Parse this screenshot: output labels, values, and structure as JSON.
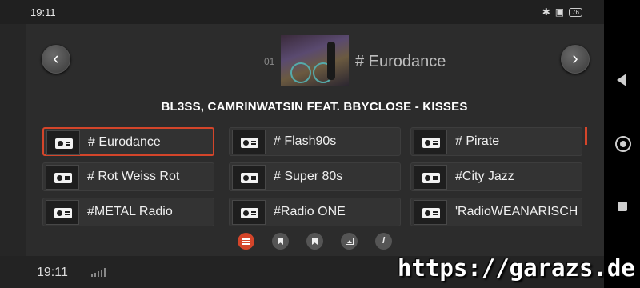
{
  "status_bar": {
    "time": "19:11",
    "bluetooth_icon": "bluetooth-icon",
    "battery_level": "76"
  },
  "player": {
    "track_number": "01",
    "station": "# Eurodance",
    "now_playing": "BL3SS, CAMRINWATSIN FEAT. BBYCLOSE - KISSES",
    "prev_icon": "‹",
    "next_icon": "›"
  },
  "stations": [
    {
      "label": "# Eurodance",
      "selected": true
    },
    {
      "label": "# Flash90s",
      "selected": false
    },
    {
      "label": "# Pirate",
      "selected": false
    },
    {
      "label": "# Rot Weiss Rot",
      "selected": false
    },
    {
      "label": "# Super 80s",
      "selected": false
    },
    {
      "label": "#City Jazz",
      "selected": false
    },
    {
      "label": "#METAL Radio",
      "selected": false
    },
    {
      "label": "#Radio ONE",
      "selected": false
    },
    {
      "label": "'RadioWEANARISCH",
      "selected": false
    }
  ],
  "toolbar": {
    "info_label": "i"
  },
  "bottom_bar": {
    "time": "19:11"
  },
  "watermark": "https://garazs.de",
  "colors": {
    "accent": "#d4452a",
    "background": "#2c2c2c"
  }
}
